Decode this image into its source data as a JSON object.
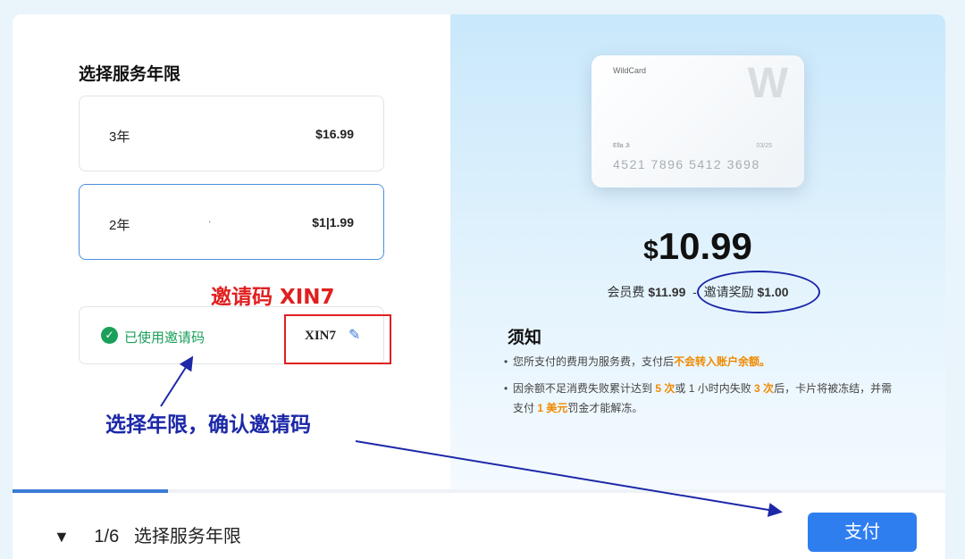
{
  "section_title": "选择服务年限",
  "options": [
    {
      "years": "3年",
      "price": "$16.99",
      "selected": false
    },
    {
      "years": "2年",
      "price": "$1|1.99",
      "selected": true,
      "marker": "·"
    }
  ],
  "invite": {
    "status": "已使用邀请码",
    "code": "XIN7",
    "edit_icon": "✎"
  },
  "annotations": {
    "red_label": "邀请码 XIN7",
    "blue_label": "选择年限，确认邀请码"
  },
  "card": {
    "brand": "WildCard",
    "logo": "W",
    "holder": "Ella Ji",
    "expiry": "03/25",
    "number": "4521 7896 5412 3698"
  },
  "price": {
    "currency": "$",
    "amount": "10.99",
    "fee_label": "会员费",
    "fee_value": "$11.99",
    "separator": "-",
    "reward_label": "邀请奖励",
    "reward_value": "$1.00"
  },
  "notice": {
    "title": "须知",
    "item1_a": "您所支付的费用为服务费，支付后",
    "item1_hl": "不会转入账户余额。",
    "item2_a": "因余额不足消费失败累计达到 ",
    "item2_hl1": "5 次",
    "item2_b": "或 1 小时内失败 ",
    "item2_hl2": "3 次",
    "item2_c": "后，卡片将被冻结，并需支付 ",
    "item2_hl3": "1 美元",
    "item2_d": "罚金才能解冻。"
  },
  "footer": {
    "toggle_icon": "▼",
    "step": "1/6",
    "step_label": "选择服务年限",
    "progress": 0.167
  },
  "pay_button": "支付",
  "colors": {
    "accent": "#2f7ef0",
    "success": "#1aa05a",
    "highlight": "#f08a00",
    "annotation_red": "#e02020",
    "annotation_blue": "#1c28a8"
  }
}
